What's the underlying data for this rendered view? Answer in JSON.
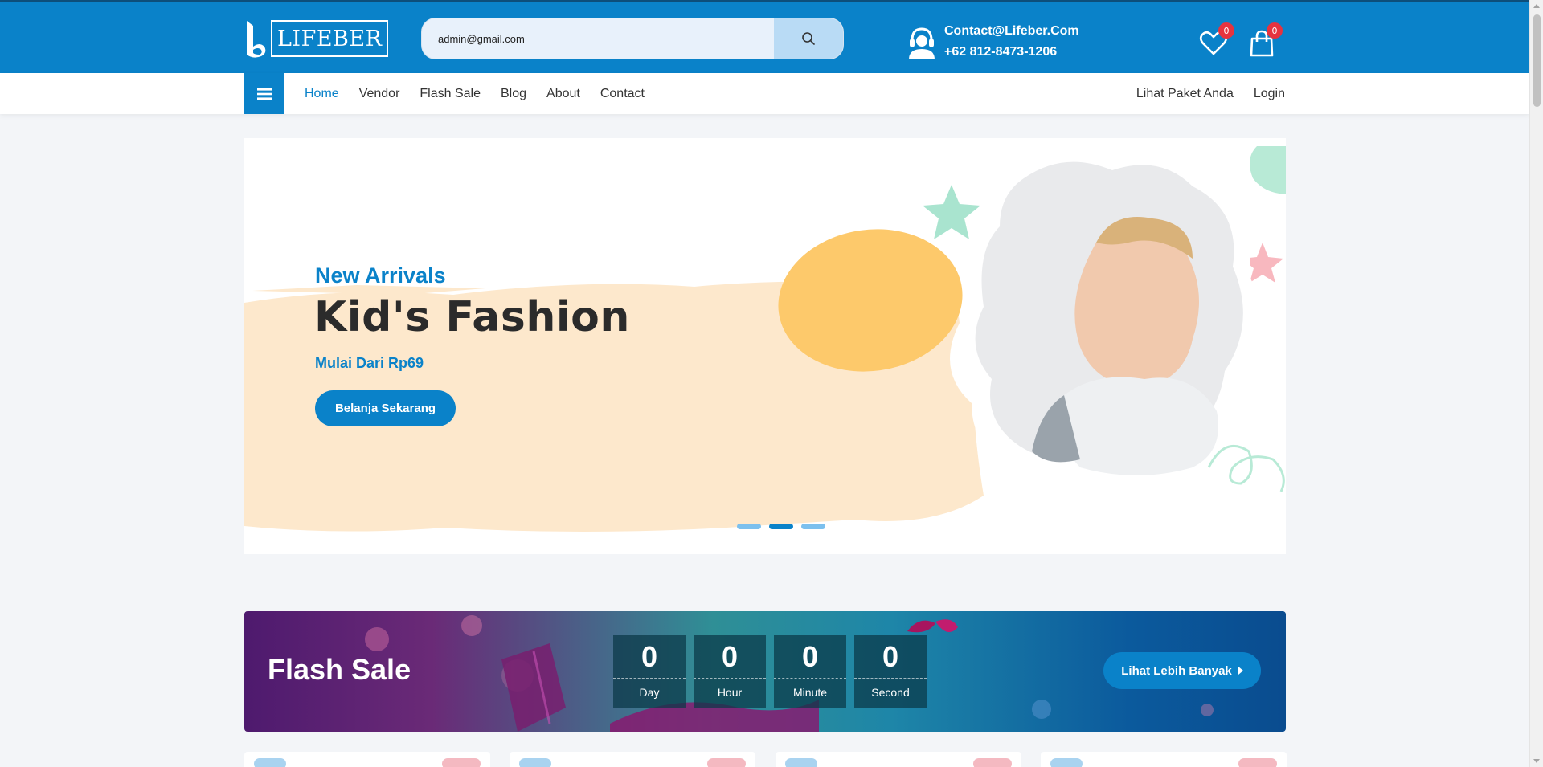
{
  "header": {
    "logo_text": "LIFEBER",
    "search_value": "admin@gmail.com",
    "contact_email": "Contact@Lifeber.Com",
    "contact_phone": "+62 812-8473-1206",
    "wishlist_count": "0",
    "cart_count": "0"
  },
  "nav": {
    "links": [
      "Home",
      "Vendor",
      "Flash Sale",
      "Blog",
      "About",
      "Contact"
    ],
    "right": [
      "Lihat Paket Anda",
      "Login"
    ]
  },
  "hero": {
    "subtitle": "New Arrivals",
    "title": "Kid's Fashion",
    "price": "Mulai Dari Rp69",
    "button": "Belanja Sekarang",
    "active_slide": 2
  },
  "flash_sale": {
    "title": "Flash Sale",
    "countdown": [
      {
        "value": "0",
        "label": "Day"
      },
      {
        "value": "0",
        "label": "Hour"
      },
      {
        "value": "0",
        "label": "Minute"
      },
      {
        "value": "0",
        "label": "Second"
      }
    ],
    "button": "Lihat Lebih Banyak"
  },
  "colors": {
    "primary": "#0a82c9",
    "badge": "#e6333f"
  }
}
